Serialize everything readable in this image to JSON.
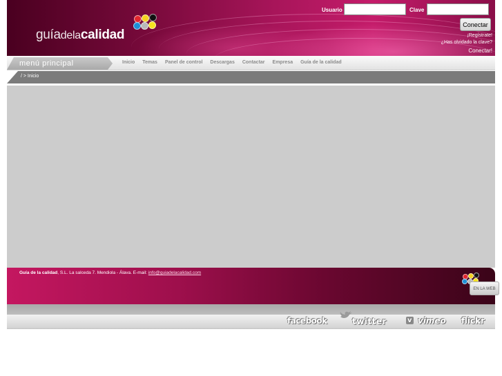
{
  "header": {
    "logo": {
      "part1": "guía",
      "part2": "dela",
      "part3": "calidad"
    },
    "login": {
      "user_label": "Usuario",
      "user_value": "",
      "password_label": "Clave",
      "password_value": "",
      "connect_button": "Conectar",
      "register_link": "¡Regístrate!",
      "forgot_link": "¿Has olvidado la clave?",
      "connect_link": "Conectar!"
    }
  },
  "menu": {
    "title": "menú principal",
    "items": [
      "Inicio",
      "Temas",
      "Panel de control",
      "Descargas",
      "Contactar",
      "Empresa",
      "Guía de la calidad"
    ]
  },
  "breadcrumb": "/ > Inicio",
  "footer": {
    "company": "Guía de la calidad",
    "address": ", S.L. La salceda 7. Mendiola - Álava. E-mail:",
    "email": "info@guiadelacalidad.com",
    "badge": "EN LA WEB"
  },
  "social": {
    "facebook": "facebook",
    "twitter": "twitter",
    "vimeo_v": "v",
    "vimeo": "vimeo",
    "flickr": "flickr"
  },
  "colors": {
    "header_primary": "#a8155a",
    "footer_primary": "#c41760",
    "content_bg": "#cccccc"
  }
}
